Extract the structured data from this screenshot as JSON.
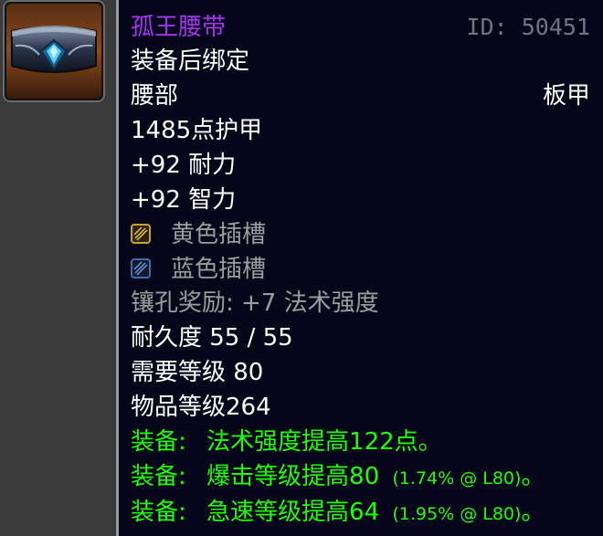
{
  "item": {
    "name": "孤王腰带",
    "id_text": "ID: 50451",
    "binding": "装备后绑定",
    "slot": "腰部",
    "armor_type": "板甲",
    "armor": "1485点护甲",
    "stats": [
      "+92 耐力",
      "+92 智力"
    ],
    "sockets": [
      {
        "label": "黄色插槽",
        "icon": "yellow-socket-icon",
        "color": "#c9a227"
      },
      {
        "label": "蓝色插槽",
        "icon": "blue-socket-icon",
        "color": "#3d6fb0"
      }
    ],
    "socket_bonus": "镶孔奖励: +7 法术强度",
    "durability": "耐久度 55 / 55",
    "required_level": "需要等级 80",
    "item_level": "物品等级264",
    "equip_effects": [
      {
        "prefix": "装备:",
        "text": "法术强度提高122点。",
        "note": "",
        "suffix": ""
      },
      {
        "prefix": "装备:",
        "text": "爆击等级提高80",
        "note": "(1.74% @ L80)",
        "suffix": "。"
      },
      {
        "prefix": "装备:",
        "text": "急速等级提高64",
        "note": "(1.95% @ L80)",
        "suffix": "。"
      }
    ]
  },
  "colors": {
    "epic": "#a335ee",
    "equip_green": "#1eff00",
    "grey": "#9d9d9d",
    "tooltip_bg": "#06061a"
  }
}
